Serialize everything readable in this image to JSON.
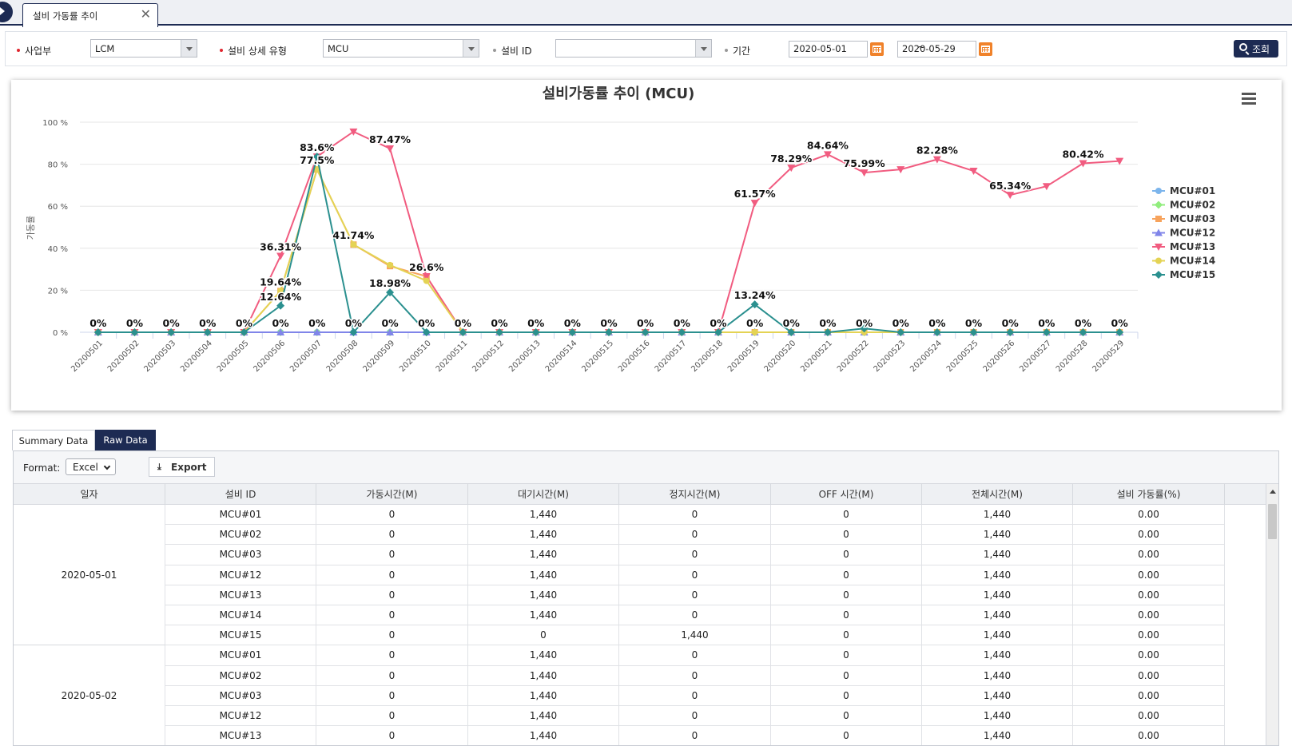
{
  "tab": {
    "label": "설비 가동률 추이",
    "close": "✕"
  },
  "filters": {
    "business_label": "사업부",
    "business_value": "LCM",
    "type_label": "설비 상세 유형",
    "type_value": "MCU",
    "equip_id_label": "설비 ID",
    "equip_id_value": "",
    "period_label": "기간",
    "date_from": "2020-05-01",
    "date_sep": "~",
    "date_to": "2020-05-29",
    "search_label": "조회",
    "required_color": "#e0262f",
    "optional_color": "#999999"
  },
  "chart_data": {
    "type": "line",
    "title": "설비가동률 추이 (MCU)",
    "ylabel": "가동률",
    "xlabel": "",
    "ylim": [
      0,
      100
    ],
    "yticks": [
      "0 %",
      "20 %",
      "40 %",
      "60 %",
      "80 %",
      "100 %"
    ],
    "grid": true,
    "legend": "right",
    "categories": [
      "20200501",
      "20200502",
      "20200503",
      "20200504",
      "20200505",
      "20200506",
      "20200507",
      "20200508",
      "20200509",
      "20200510",
      "20200511",
      "20200512",
      "20200513",
      "20200514",
      "20200515",
      "20200516",
      "20200517",
      "20200518",
      "20200519",
      "20200520",
      "20200521",
      "20200522",
      "20200523",
      "20200524",
      "20200525",
      "20200526",
      "20200527",
      "20200528",
      "20200529"
    ],
    "series": [
      {
        "name": "MCU#01",
        "color": "#7cb5ec",
        "marker": "circle",
        "values": [
          0,
          0,
          0,
          0,
          0,
          0,
          0,
          0,
          0,
          0,
          0,
          0,
          0,
          0,
          0,
          0,
          0,
          0,
          0,
          0,
          0,
          0,
          0,
          0,
          0,
          0,
          0,
          0,
          0
        ]
      },
      {
        "name": "MCU#02",
        "color": "#90ed7d",
        "marker": "diamond",
        "values": [
          0,
          0,
          0,
          0,
          0,
          0,
          0,
          0,
          0,
          0,
          0,
          0,
          0,
          0,
          0,
          0,
          0,
          0,
          0,
          0,
          0,
          0,
          0,
          0,
          0,
          0,
          0,
          0,
          0
        ]
      },
      {
        "name": "MCU#03",
        "color": "#f7a35c",
        "marker": "square",
        "values": [
          0,
          0,
          0,
          0,
          0,
          19.64,
          77.5,
          41.74,
          31.5,
          26.6,
          0,
          0,
          0,
          0,
          0,
          0,
          0,
          0,
          0,
          0,
          0,
          0,
          0,
          0,
          0,
          0,
          0,
          0,
          0
        ]
      },
      {
        "name": "MCU#12",
        "color": "#8085e9",
        "marker": "triangle",
        "values": [
          0,
          0,
          0,
          0,
          0,
          0,
          0,
          0,
          0,
          0,
          0,
          0,
          0,
          0,
          0,
          0,
          0,
          0,
          0,
          0,
          0,
          0,
          0,
          0,
          0,
          0,
          0,
          0,
          0
        ]
      },
      {
        "name": "MCU#13",
        "color": "#f15c80",
        "marker": "triangle-down",
        "values": [
          0,
          0,
          0,
          0,
          0,
          36.31,
          83.6,
          95.5,
          87.47,
          26.6,
          0,
          0,
          0,
          0,
          0,
          0,
          0,
          0,
          61.57,
          78.29,
          84.64,
          75.99,
          77.5,
          82.28,
          76.8,
          65.34,
          69.5,
          80.42,
          81.5
        ]
      },
      {
        "name": "MCU#14",
        "color": "#e4d354",
        "marker": "circle",
        "values": [
          0,
          0,
          0,
          0,
          0,
          19.64,
          77.5,
          41.74,
          32,
          24.5,
          0,
          0,
          0,
          0,
          0,
          0,
          0,
          0,
          0,
          0,
          0,
          0,
          0,
          0,
          0,
          0,
          0,
          0,
          0
        ]
      },
      {
        "name": "MCU#15",
        "color": "#2b908f",
        "marker": "diamond",
        "values": [
          0,
          0,
          0,
          0,
          0,
          12.64,
          83.6,
          0,
          18.98,
          0,
          0,
          0,
          0,
          0,
          0,
          0,
          0,
          0,
          13.24,
          0,
          0,
          1.8,
          0,
          0,
          0,
          0,
          0,
          0,
          0
        ]
      }
    ],
    "data_labels": [
      {
        "i": 0,
        "v": 0,
        "text": "0%"
      },
      {
        "i": 1,
        "v": 0,
        "text": "0%"
      },
      {
        "i": 2,
        "v": 0,
        "text": "0%"
      },
      {
        "i": 3,
        "v": 0,
        "text": "0%"
      },
      {
        "i": 4,
        "v": 0,
        "text": "0%"
      },
      {
        "i": 5,
        "v": 0,
        "text": "0%"
      },
      {
        "i": 5,
        "v": 36.31,
        "text": "36.31%"
      },
      {
        "i": 5,
        "v": 19.64,
        "text": "19.64%"
      },
      {
        "i": 5,
        "v": 12.64,
        "text": "12.64%"
      },
      {
        "i": 6,
        "v": 0,
        "text": "0%"
      },
      {
        "i": 6,
        "v": 83.6,
        "text": "83.6%"
      },
      {
        "i": 6,
        "v": 77.5,
        "text": "77.5%"
      },
      {
        "i": 7,
        "v": 0,
        "text": "0%"
      },
      {
        "i": 7,
        "v": 41.74,
        "text": "41.74%"
      },
      {
        "i": 8,
        "v": 0,
        "text": "0%"
      },
      {
        "i": 8,
        "v": 87.47,
        "text": "87.47%"
      },
      {
        "i": 8,
        "v": 18.98,
        "text": "18.98%"
      },
      {
        "i": 9,
        "v": 0,
        "text": "0%"
      },
      {
        "i": 9,
        "v": 26.6,
        "text": "26.6%"
      },
      {
        "i": 10,
        "v": 0,
        "text": "0%"
      },
      {
        "i": 11,
        "v": 0,
        "text": "0%"
      },
      {
        "i": 12,
        "v": 0,
        "text": "0%"
      },
      {
        "i": 13,
        "v": 0,
        "text": "0%"
      },
      {
        "i": 14,
        "v": 0,
        "text": "0%"
      },
      {
        "i": 15,
        "v": 0,
        "text": "0%"
      },
      {
        "i": 16,
        "v": 0,
        "text": "0%"
      },
      {
        "i": 17,
        "v": 0,
        "text": "0%"
      },
      {
        "i": 18,
        "v": 0,
        "text": "0%"
      },
      {
        "i": 18,
        "v": 61.57,
        "text": "61.57%"
      },
      {
        "i": 18,
        "v": 13.24,
        "text": "13.24%"
      },
      {
        "i": 19,
        "v": 0,
        "text": "0%"
      },
      {
        "i": 19,
        "v": 78.29,
        "text": "78.29%"
      },
      {
        "i": 20,
        "v": 0,
        "text": "0%"
      },
      {
        "i": 20,
        "v": 84.64,
        "text": "84.64%"
      },
      {
        "i": 21,
        "v": 0,
        "text": "0%"
      },
      {
        "i": 21,
        "v": 75.99,
        "text": "75.99%"
      },
      {
        "i": 22,
        "v": 0,
        "text": "0%"
      },
      {
        "i": 23,
        "v": 0,
        "text": "0%"
      },
      {
        "i": 23,
        "v": 82.28,
        "text": "82.28%"
      },
      {
        "i": 24,
        "v": 0,
        "text": "0%"
      },
      {
        "i": 25,
        "v": 0,
        "text": "0%"
      },
      {
        "i": 25,
        "v": 65.34,
        "text": "65.34%"
      },
      {
        "i": 26,
        "v": 0,
        "text": "0%"
      },
      {
        "i": 27,
        "v": 0,
        "text": "0%"
      },
      {
        "i": 27,
        "v": 80.42,
        "text": "80.42%"
      },
      {
        "i": 28,
        "v": 0,
        "text": "0%"
      }
    ]
  },
  "data_tabs": {
    "summary": "Summary Data",
    "raw": "Raw Data"
  },
  "toolbar": {
    "format_label": "Format:",
    "format_value": "Excel",
    "export_icon": "download-icon",
    "export_label": "Export"
  },
  "table": {
    "columns": [
      "일자",
      "설비 ID",
      "가동시간(M)",
      "대기시간(M)",
      "정지시간(M)",
      "OFF 시간(M)",
      "전체시간(M)",
      "설비 가동률(%)"
    ],
    "groups": [
      {
        "date": "2020-05-01",
        "rows": [
          [
            "MCU#01",
            "0",
            "1,440",
            "0",
            "0",
            "1,440",
            "0.00"
          ],
          [
            "MCU#02",
            "0",
            "1,440",
            "0",
            "0",
            "1,440",
            "0.00"
          ],
          [
            "MCU#03",
            "0",
            "1,440",
            "0",
            "0",
            "1,440",
            "0.00"
          ],
          [
            "MCU#12",
            "0",
            "1,440",
            "0",
            "0",
            "1,440",
            "0.00"
          ],
          [
            "MCU#13",
            "0",
            "1,440",
            "0",
            "0",
            "1,440",
            "0.00"
          ],
          [
            "MCU#14",
            "0",
            "1,440",
            "0",
            "0",
            "1,440",
            "0.00"
          ],
          [
            "MCU#15",
            "0",
            "0",
            "1,440",
            "0",
            "1,440",
            "0.00"
          ]
        ]
      },
      {
        "date": "2020-05-02",
        "rows": [
          [
            "MCU#01",
            "0",
            "1,440",
            "0",
            "0",
            "1,440",
            "0.00"
          ],
          [
            "MCU#02",
            "0",
            "1,440",
            "0",
            "0",
            "1,440",
            "0.00"
          ],
          [
            "MCU#03",
            "0",
            "1,440",
            "0",
            "0",
            "1,440",
            "0.00"
          ],
          [
            "MCU#12",
            "0",
            "1,440",
            "0",
            "0",
            "1,440",
            "0.00"
          ],
          [
            "MCU#13",
            "0",
            "1,440",
            "0",
            "0",
            "1,440",
            "0.00"
          ]
        ]
      }
    ]
  },
  "colors": {
    "primary_navy": "#1d2b53",
    "calendar_orange": "#f0822a"
  }
}
